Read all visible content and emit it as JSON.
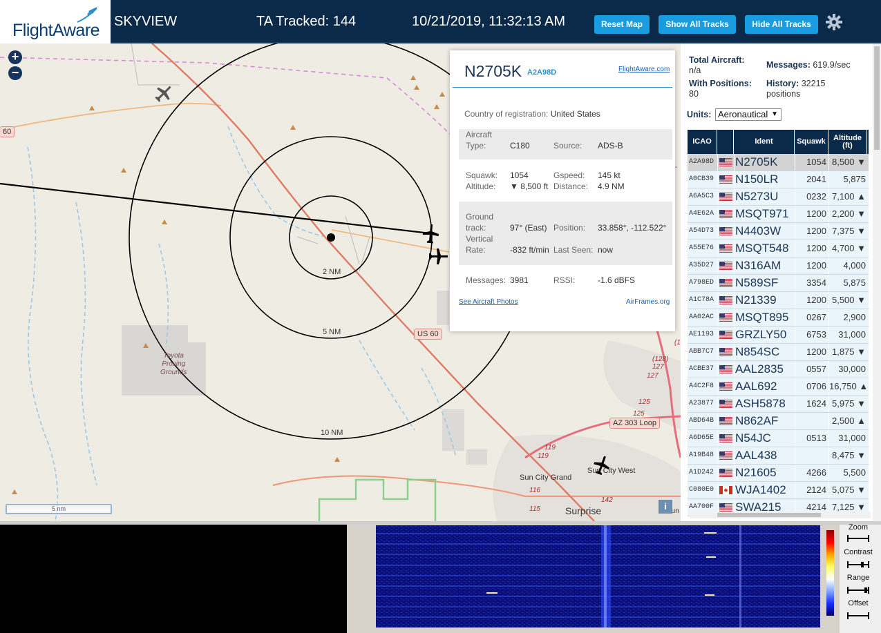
{
  "header": {
    "logo_text": "FlightAware",
    "title": "SKYVIEW",
    "tracked": "TA Tracked: 144",
    "datetime": "10/21/2019, 11:32:13 AM",
    "btn_reset": "Reset Map",
    "btn_show": "Show All Tracks",
    "btn_hide": "Hide All Tracks",
    "settings_icon": "gear-icon"
  },
  "map": {
    "zoom_in": "+",
    "zoom_out": "−",
    "range_rings": [
      "2 NM",
      "5 NM",
      "10 NM"
    ],
    "places": {
      "toyota": "Toyota\nProving\nGrounds",
      "sun_city_grand": "Sun City Grand",
      "sun_city_west": "Sun City West",
      "surprise": "Surprise"
    },
    "roads": {
      "us60": "US 60",
      "az303": "AZ 303 Loop",
      "r60_edge": "60",
      "r128": "(128)",
      "r127a": "127",
      "r127b": "127",
      "r125a": "125",
      "r125b": "125",
      "r119a": "119",
      "r119b": "119",
      "r116": "116",
      "r115": "115",
      "r142": "142",
      "r1": "(1",
      "sun_c": "Sun C"
    },
    "scale": "5 nm",
    "info": "i"
  },
  "popup": {
    "ident": "N2705K",
    "hex": "A2A98D",
    "fa_link": "FlightAware.com",
    "country_label": "Country of registration:",
    "country": "United States",
    "aircraft_label": "Aircraft",
    "type_label": "Type:",
    "type": "C180",
    "source_label": "Source:",
    "source": "ADS-B",
    "squawk_label": "Squawk:",
    "squawk": "1054",
    "gspeed_label": "Gspeed:",
    "gspeed": "145 kt",
    "altitude_label": "Altitude:",
    "altitude": "▼ 8,500 ft",
    "distance_label": "Distance:",
    "distance": "4.9 NM",
    "ground_label": "Ground",
    "track_label": "track:",
    "track": "97° (East)",
    "position_label": "Position:",
    "position": "33.858°, -112.522°",
    "vertical_label": "Vertical",
    "rate_label": "Rate:",
    "rate": "-832 ft/min",
    "last_seen_label": "Last Seen:",
    "last_seen": "now",
    "messages_label": "Messages:",
    "messages": "3981",
    "rssi_label": "RSSI:",
    "rssi": "-1.6 dBFS",
    "photos_link": "See Aircraft Photos",
    "airframes_link": "AirFrames.org"
  },
  "sidebar": {
    "total_label": "Total Aircraft:",
    "total_value": "n/a",
    "with_pos_label": "With Positions:",
    "with_pos_value": "80",
    "messages_label": "Messages:",
    "messages_value": "619.9/sec",
    "history_label": "History:",
    "history_value": "32215",
    "history_unit": "positions",
    "units_label": "Units:",
    "units_value": "Aeronautical",
    "columns": [
      "ICAO",
      "Ident",
      "Squawk",
      "Altitude (ft)"
    ],
    "rows": [
      {
        "icao": "A2A98D",
        "flag": "us",
        "ident": "N2705K",
        "squawk": "1054",
        "alt": "8,500 ▼"
      },
      {
        "icao": "A0CB39",
        "flag": "us",
        "ident": "N150LR",
        "squawk": "2041",
        "alt": "5,875"
      },
      {
        "icao": "A6A5C3",
        "flag": "us",
        "ident": "N5273U",
        "squawk": "0232",
        "alt": "7,100 ▲"
      },
      {
        "icao": "A4E62A",
        "flag": "us",
        "ident": "MSQT971",
        "squawk": "1200",
        "alt": "2,200 ▼"
      },
      {
        "icao": "A54D73",
        "flag": "us",
        "ident": "N4403W",
        "squawk": "1200",
        "alt": "7,375 ▼"
      },
      {
        "icao": "A55E76",
        "flag": "us",
        "ident": "MSQT548",
        "squawk": "1200",
        "alt": "4,700 ▼"
      },
      {
        "icao": "A35D27",
        "flag": "us",
        "ident": "N316AM",
        "squawk": "1200",
        "alt": "4,000"
      },
      {
        "icao": "A798ED",
        "flag": "us",
        "ident": "N589SF",
        "squawk": "3354",
        "alt": "5,875"
      },
      {
        "icao": "A1C78A",
        "flag": "us",
        "ident": "N21339",
        "squawk": "1200",
        "alt": "5,500 ▼"
      },
      {
        "icao": "AA02AC",
        "flag": "us",
        "ident": "MSQT895",
        "squawk": "0267",
        "alt": "2,900"
      },
      {
        "icao": "AE1193",
        "flag": "us",
        "ident": "GRZLY50",
        "squawk": "6753",
        "alt": "31,000"
      },
      {
        "icao": "ABB7C7",
        "flag": "us",
        "ident": "N854SC",
        "squawk": "1200",
        "alt": "1,875 ▼"
      },
      {
        "icao": "ACBE37",
        "flag": "us",
        "ident": "AAL2835",
        "squawk": "0557",
        "alt": "30,000"
      },
      {
        "icao": "A4C2F8",
        "flag": "us",
        "ident": "AAL692",
        "squawk": "0706",
        "alt": "16,750 ▲"
      },
      {
        "icao": "A23877",
        "flag": "us",
        "ident": "ASH5878",
        "squawk": "1624",
        "alt": "5,975 ▼"
      },
      {
        "icao": "ABD64B",
        "flag": "us",
        "ident": "N862AF",
        "squawk": "",
        "alt": "2,500 ▲"
      },
      {
        "icao": "A6D65E",
        "flag": "us",
        "ident": "N54JC",
        "squawk": "0513",
        "alt": "31,000"
      },
      {
        "icao": "A19B48",
        "flag": "us",
        "ident": "AAL438",
        "squawk": "",
        "alt": "8,475 ▼"
      },
      {
        "icao": "A1D242",
        "flag": "us",
        "ident": "N21605",
        "squawk": "4266",
        "alt": "5,500"
      },
      {
        "icao": "C080E0",
        "flag": "ca",
        "ident": "WJA1402",
        "squawk": "2124",
        "alt": "5,075 ▼"
      },
      {
        "icao": "AA700F",
        "flag": "us",
        "ident": "SWA215",
        "squawk": "4214",
        "alt": "7,125 ▼"
      }
    ]
  },
  "spectrum": {
    "zoom": "Zoom",
    "contrast": "Contrast",
    "range": "Range",
    "offset": "Offset"
  },
  "colors": {
    "header_bg": "#0b2a4a",
    "button": "#1a9ce0",
    "table_header": "#0b2a4a",
    "row_bg": "#eaf4fb",
    "selected_row": "#d3d3d3"
  }
}
